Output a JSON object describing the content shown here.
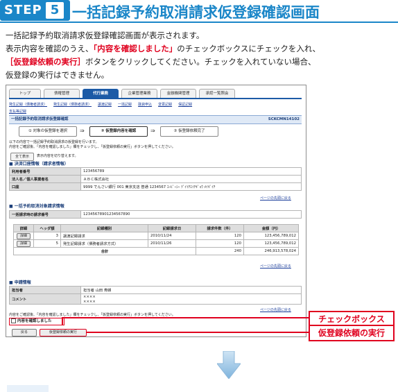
{
  "header": {
    "step_word": "STEP",
    "step_number": "5",
    "title": "一括記録予約取消請求仮登録確認画面"
  },
  "intro": {
    "line1": "一括記録予約取消請求仮登録確認画面が表示されます。",
    "line2_a": "表示内容を確認のうえ、",
    "line2_red": "「内容を確認しました」",
    "line2_b": "のチェックボックスにチェックを入れ、",
    "line3_red": "［仮登録依頼の実行］",
    "line3_b": "ボタンをクリックしてください。チェックを入れていない場合、",
    "line4": "仮登録の実行はできません。"
  },
  "screen": {
    "tabs": [
      "トップ",
      "債権管理",
      "代行業務",
      "企業管理業務",
      "金融機関管理",
      "承認一覧照会"
    ],
    "active_tab_index": 2,
    "sublinks_line1": [
      "発生記録（債権者請求）",
      "発生記録（債務者請求）",
      "譲渡記録",
      "一括記録",
      "融資申込",
      "変更記録",
      "保証記録"
    ],
    "sublinks_line2": [
      "支払等記録"
    ],
    "page_title": "一括記録予約取消請求仮登録確認",
    "screen_id": "SCKCMN14102",
    "steps": [
      "① 対象の仮登録を選択",
      "② 仮登録内容を確認",
      "③ 仮登録依頼完了"
    ],
    "notice1": "以下の内容で一括記録予約取消請求の仮登録を行います。",
    "notice2": "内容をご確認後、「内容を確認しました」欄をチェックし、「仮登録依頼の実行」ボタンを押してください。",
    "show_all_button": "全て表示",
    "show_all_note": "表示内容を切り替えます。",
    "settlement_section": "決済口座情報（請求者情報）",
    "settlement_rows": [
      {
        "label": "利用者番号",
        "value": "123456789"
      },
      {
        "label": "法人名／個人事業者名",
        "value": "ＡＢＣ株式会社"
      },
      {
        "label": "口座",
        "value": "9999 でんさい銀行 001 東京支店 普通 1234567 ｴｰﾋﾞｰｼｰ ﾃﾞｲｲﾁｴｲﾁｷﾞｮｳ ﾒｲｷﾞｲﾁ"
      }
    ],
    "to_top_link": "ページの先頭に戻る",
    "target_section": "一括予約取消対象請求情報",
    "batch_label": "一括請求時の請求番号",
    "batch_value": "12345678901234567890",
    "detail_headers": [
      "詳細",
      "ヘッダ額",
      "記録種別",
      "記録請求日",
      "請求件数（件）",
      "金額（円）"
    ],
    "detail_rows": [
      {
        "button": "詳細",
        "no": "3",
        "kind": "譲渡記録請求",
        "date": "2010/11/24",
        "count": "120",
        "amount": "123,456,789,012"
      },
      {
        "button": "詳細",
        "no": "5",
        "kind": "発生記録請求（債務者請求方式）",
        "date": "2010/11/26",
        "count": "120",
        "amount": "123,456,789,012"
      }
    ],
    "total_label": "合計",
    "total_count": "240",
    "total_amount": "246,913,578,024",
    "request_section": "申請情報",
    "request_rows": [
      {
        "label": "担当者",
        "value": "担当者 山田 寿朗"
      },
      {
        "label": "コメント",
        "value": "××××"
      },
      {
        "label": "",
        "value": "××××"
      }
    ],
    "confirm_note": "内容をご確認後、「内容を確認しました」欄をチェックし、「仮登録依頼の実行」ボタンを押してください。",
    "confirm_checkbox_label": "内容を確認しました",
    "back_button": "戻る",
    "execute_button": "仮登録依頼の実行"
  },
  "callouts": {
    "checkbox": "チェックボックス",
    "execute": "仮登録依頼の実行"
  },
  "colors": {
    "brand_blue": "#1a86c8",
    "tab_active": "#1c5aa6",
    "emphasis_red": "#e0001e"
  }
}
